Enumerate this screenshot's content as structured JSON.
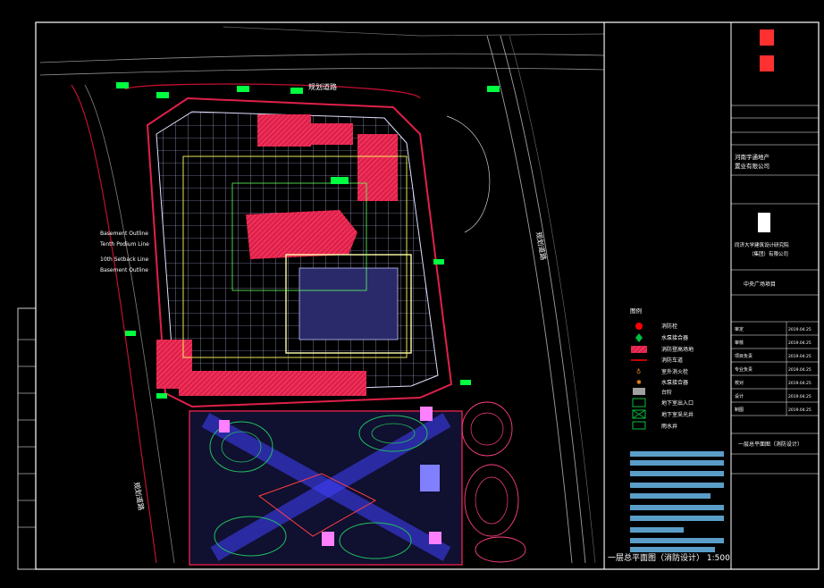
{
  "drawing": {
    "caption": "一层总平面图（消防设计）  1:500",
    "colors": {
      "background": "#000000",
      "frame": "#ffffff",
      "building": "#e0e0ff",
      "fire_zone": "#e0204a",
      "road": "#c01030",
      "grid": "#d0d0ff",
      "landscape": "#20c060",
      "tag": "#00ff40",
      "text_block": "#5a9ec8",
      "legend_red": "#ff0000",
      "legend_green": "#00c040"
    },
    "side_labels": [
      {
        "line1": "Basement Outline",
        "line2": "Tenth Podium Line"
      },
      {
        "line1": "10th Setback Line",
        "line2": "Basement Outline"
      }
    ],
    "street_labels": [
      "规划道路",
      "规划道路",
      "规划道路"
    ],
    "legend": {
      "title": "图例",
      "items": [
        {
          "icon": "red-circle",
          "label": "消防栓"
        },
        {
          "icon": "green-diamond",
          "label": "水泵接合器"
        },
        {
          "icon": "hatch-red",
          "label": "消防登高场地"
        },
        {
          "icon": "red-line",
          "label": "消防车道"
        },
        {
          "icon": "orange-mark",
          "label": "室外消火栓"
        },
        {
          "icon": "orange-mark",
          "label": "水泵接合器"
        },
        {
          "icon": "gray-rect",
          "label": "台阶"
        },
        {
          "icon": "green-box",
          "label": "地下室出入口"
        },
        {
          "icon": "green-x-box",
          "label": "地下室采光井"
        },
        {
          "icon": "green-rect",
          "label": "雨水井"
        }
      ]
    },
    "title_block": {
      "company": "河南宇通地产",
      "company2": "置业有限公司",
      "institute": "同济大学建筑设计研究院",
      "institute2": "（集团）有限公司",
      "project": "中央广场项目",
      "sheet_title": "一层总平面图（消防设计）",
      "rows": [
        "审定",
        "审核",
        "项目负责",
        "专业负责",
        "校对",
        "设计",
        "制图"
      ],
      "dates": [
        "2019.04.25",
        "2019.04.25",
        "2019.04.25",
        "2019.04.25",
        "2019.04.25",
        "2019.04.25",
        "2019.04.25"
      ]
    }
  }
}
